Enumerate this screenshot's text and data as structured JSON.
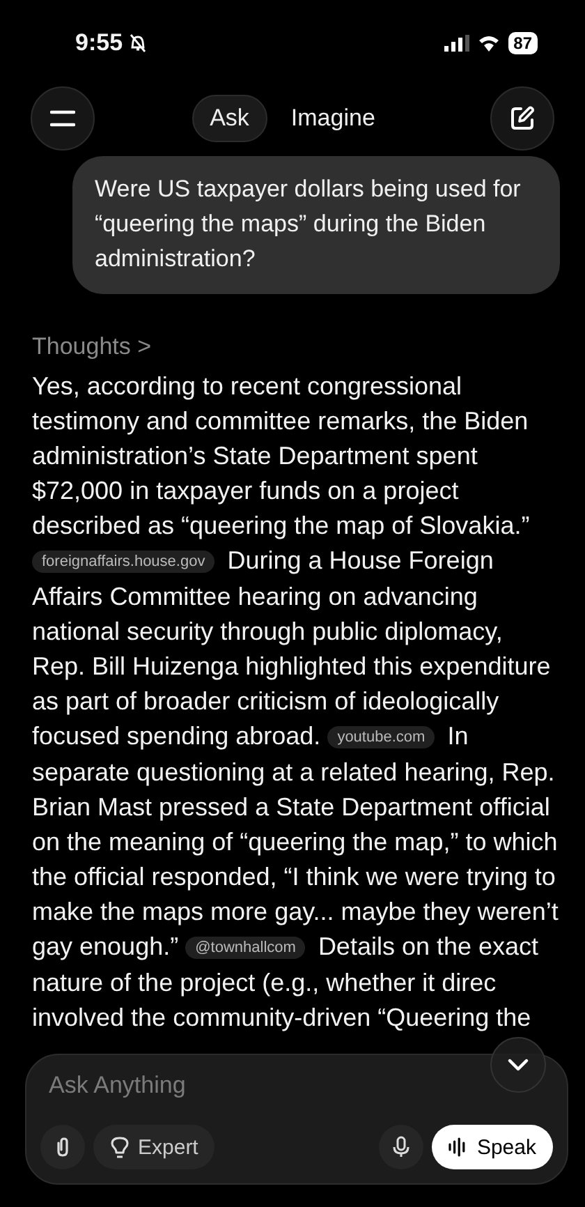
{
  "status_bar": {
    "time": "9:55",
    "battery": "87"
  },
  "header": {
    "modes": [
      {
        "label": "Ask",
        "selected": true
      },
      {
        "label": "Imagine",
        "selected": false
      }
    ]
  },
  "user_message": "Were US taxpayer dollars being used for “queering the maps” during the Biden administration?",
  "thoughts": {
    "label": "Thoughts",
    "chevron": ">"
  },
  "answer": [
    {
      "kind": "text",
      "text": "Yes, according to recent congressional testimony and committee remarks, the Biden administration’s State Department spent $72,000 in taxpayer funds on a project described as “queering the map of Slovakia.”"
    },
    {
      "kind": "source",
      "text": "foreignaffairs.house.gov"
    },
    {
      "kind": "text",
      "text": "During a House Foreign Affairs Committee hearing on advancing national security through public diplomacy, Rep. Bill Huizenga highlighted this expenditure as part of broader criticism of ideologically focused spending abroad."
    },
    {
      "kind": "source",
      "text": "youtube.com"
    },
    {
      "kind": "text",
      "text": "In separate questioning at a related hearing, Rep. Brian Mast pressed a State Department official on the meaning of “queering the map,” to which the official responded, “I think we were trying to make the maps more gay... maybe they weren’t gay enough.”"
    },
    {
      "kind": "source",
      "text": "@townhallcom"
    },
    {
      "kind": "text",
      "text": "Details on the exact nature of the project (e.g., whether it direc"
    },
    {
      "kind": "text",
      "text": "involved the community-driven “Queering the"
    }
  ],
  "composer": {
    "placeholder": "Ask Anything",
    "mode_button": "Expert",
    "speak_button": "Speak"
  }
}
